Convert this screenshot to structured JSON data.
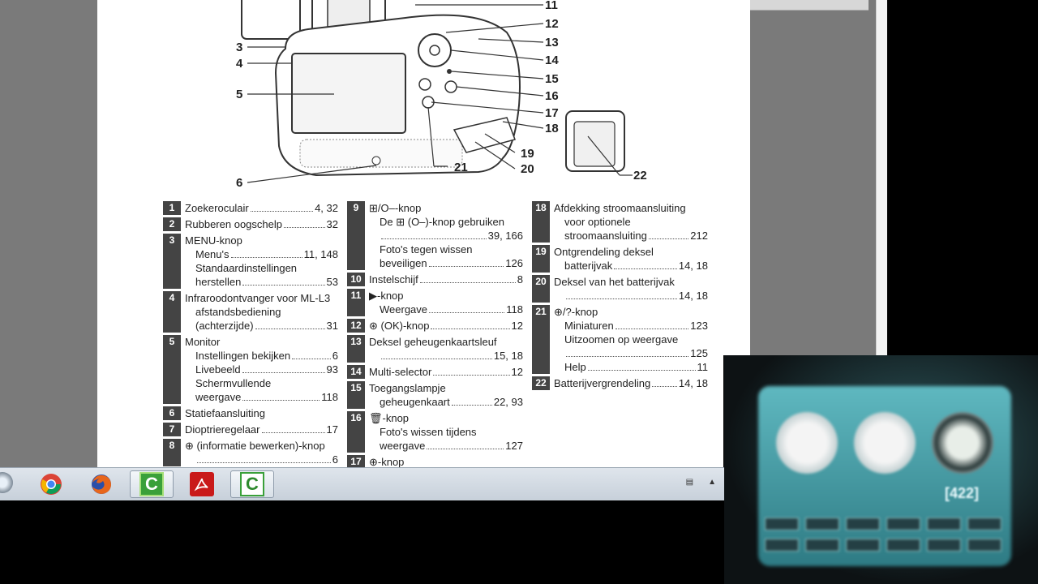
{
  "diagram": {
    "callouts": [
      "11",
      "12",
      "13",
      "14",
      "15",
      "16",
      "17",
      "18",
      "19",
      "20",
      "21",
      "22",
      "3",
      "4",
      "5",
      "6"
    ]
  },
  "legend": {
    "col1": [
      {
        "num": "1",
        "lines": [
          {
            "text": "Zoekeroculair",
            "page": "4, 32"
          }
        ]
      },
      {
        "num": "2",
        "lines": [
          {
            "text": "Rubberen oogschelp",
            "page": "32"
          }
        ]
      },
      {
        "num": "3",
        "lines": [
          {
            "text": "MENU-knop",
            "page": ""
          },
          {
            "text": "Menu's",
            "page": "11, 148",
            "indent": true
          },
          {
            "text": "Standaardinstellingen",
            "page": "",
            "indent": true
          },
          {
            "text": "herstellen",
            "page": "53",
            "indent": true
          }
        ]
      },
      {
        "num": "4",
        "lines": [
          {
            "text": "Infraroodontvanger voor ML-L3",
            "page": ""
          },
          {
            "text": "afstandsbediening",
            "page": "",
            "indent": true
          },
          {
            "text": "(achterzijde)",
            "page": "31",
            "indent": true
          }
        ]
      },
      {
        "num": "5",
        "lines": [
          {
            "text": "Monitor",
            "page": ""
          },
          {
            "text": "Instellingen bekijken",
            "page": "6",
            "indent": true
          },
          {
            "text": "Livebeeld",
            "page": "93",
            "indent": true
          },
          {
            "text": "Schermvullende",
            "page": "",
            "indent": true
          },
          {
            "text": "weergave",
            "page": "118",
            "indent": true
          }
        ]
      },
      {
        "num": "6",
        "lines": [
          {
            "text": "Statiefaansluiting",
            "page": ""
          }
        ]
      },
      {
        "num": "7",
        "lines": [
          {
            "text": "Dioptrieregelaar",
            "page": "17"
          }
        ]
      },
      {
        "num": "8",
        "lines": [
          {
            "text": "⊕ (informatie bewerken)-knop",
            "page": ""
          },
          {
            "text": "",
            "page": "6",
            "indent": true
          }
        ]
      }
    ],
    "col2": [
      {
        "num": "9",
        "lines": [
          {
            "text": "⊞/O‒-knop",
            "page": ""
          },
          {
            "text": "De ⊞ (O‒)-knop gebruiken",
            "page": "",
            "indent": true
          },
          {
            "text": "",
            "page": "39, 166",
            "indent": true
          },
          {
            "text": "Foto's tegen wissen",
            "page": "",
            "indent": true
          },
          {
            "text": "beveiligen",
            "page": "126",
            "indent": true
          }
        ]
      },
      {
        "num": "10",
        "lines": [
          {
            "text": "Instelschijf",
            "page": "8"
          }
        ]
      },
      {
        "num": "11",
        "lines": [
          {
            "text": "▶-knop",
            "page": ""
          },
          {
            "text": "Weergave",
            "page": "118",
            "indent": true
          }
        ]
      },
      {
        "num": "12",
        "lines": [
          {
            "text": "⊛ (OK)-knop",
            "page": "12"
          }
        ]
      },
      {
        "num": "13",
        "lines": [
          {
            "text": "Deksel geheugenkaartsleuf",
            "page": ""
          },
          {
            "text": "",
            "page": "15, 18",
            "indent": true
          }
        ]
      },
      {
        "num": "14",
        "lines": [
          {
            "text": "Multi-selector",
            "page": "12"
          }
        ]
      },
      {
        "num": "15",
        "lines": [
          {
            "text": "Toegangslampje",
            "page": ""
          },
          {
            "text": "geheugenkaart",
            "page": "22, 93",
            "indent": true
          }
        ]
      },
      {
        "num": "16",
        "lines": [
          {
            "text": "🗑-knop",
            "page": ""
          },
          {
            "text": "Foto's wissen tijdens",
            "page": "",
            "indent": true
          },
          {
            "text": "weergave",
            "page": "127",
            "indent": true
          }
        ]
      },
      {
        "num": "17",
        "lines": [
          {
            "text": "⊕-knop",
            "page": ""
          }
        ]
      }
    ],
    "col3": [
      {
        "num": "18",
        "lines": [
          {
            "text": "Afdekking stroomaansluiting",
            "page": ""
          },
          {
            "text": "voor optionele",
            "page": "",
            "indent": true
          },
          {
            "text": "stroomaansluiting",
            "page": "212",
            "indent": true
          }
        ]
      },
      {
        "num": "19",
        "lines": [
          {
            "text": "Ontgrendeling deksel",
            "page": ""
          },
          {
            "text": "batterijvak",
            "page": "14, 18",
            "indent": true
          }
        ]
      },
      {
        "num": "20",
        "lines": [
          {
            "text": "Deksel van het batterijvak",
            "page": ""
          },
          {
            "text": "",
            "page": "14, 18",
            "indent": true
          }
        ]
      },
      {
        "num": "21",
        "lines": [
          {
            "text": "⊕/?-knop",
            "page": ""
          },
          {
            "text": "Miniaturen",
            "page": "123",
            "indent": true
          },
          {
            "text": "Uitzoomen op weergave",
            "page": "",
            "indent": true
          },
          {
            "text": "",
            "page": "125",
            "indent": true
          },
          {
            "text": "Help",
            "page": "11",
            "indent": true
          }
        ]
      },
      {
        "num": "22",
        "lines": [
          {
            "text": "Batterijvergrendeling",
            "page": "14, 18"
          }
        ]
      }
    ]
  },
  "taskbar": {
    "apps": [
      {
        "name": "chrome-icon",
        "label": ""
      },
      {
        "name": "firefox-icon",
        "label": ""
      },
      {
        "name": "camtasia-icon",
        "label": "C"
      },
      {
        "name": "acrobat-icon",
        "label": ""
      },
      {
        "name": "camtasia-recorder-icon",
        "label": "C"
      }
    ]
  },
  "webcam": {
    "readout": "[422]"
  }
}
